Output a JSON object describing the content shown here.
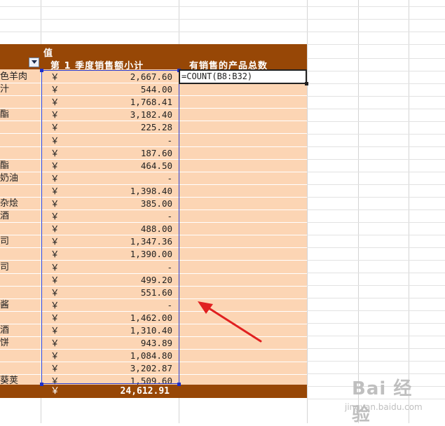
{
  "pivot": {
    "header_top": "值",
    "col1_header": "第 1 季度销售额小计",
    "col2_header": "有销售的产品总数",
    "formula": "=COUNT(B8:B32)",
    "currency": "￥",
    "total_value": "24,612.91",
    "rows": [
      {
        "name": "色羊肉",
        "value": "2,667.60"
      },
      {
        "name": "汁",
        "value": "544.00"
      },
      {
        "name": "",
        "value": "1,768.41"
      },
      {
        "name": "酯",
        "value": "3,182.40"
      },
      {
        "name": "",
        "value": "225.28"
      },
      {
        "name": "",
        "value": "-"
      },
      {
        "name": "",
        "value": "187.60"
      },
      {
        "name": "酯",
        "value": "464.50"
      },
      {
        "name": "奶油",
        "value": "-"
      },
      {
        "name": "",
        "value": "1,398.40"
      },
      {
        "name": "杂烩",
        "value": "385.00"
      },
      {
        "name": "酒",
        "value": "-"
      },
      {
        "name": "",
        "value": "488.00"
      },
      {
        "name": "司",
        "value": "1,347.36"
      },
      {
        "name": "",
        "value": "1,390.00"
      },
      {
        "name": "司",
        "value": "-"
      },
      {
        "name": "",
        "value": "499.20"
      },
      {
        "name": "",
        "value": "551.60"
      },
      {
        "name": "酱",
        "value": "-"
      },
      {
        "name": "",
        "value": "1,462.00"
      },
      {
        "name": "酒",
        "value": "1,310.40"
      },
      {
        "name": "饼",
        "value": "943.89"
      },
      {
        "name": "",
        "value": "1,084.80"
      },
      {
        "name": "",
        "value": "3,202.87"
      },
      {
        "name": "葵荚",
        "value": "1,509.60"
      }
    ]
  },
  "annotation": {
    "arrow_color": "#e02020"
  },
  "watermark": {
    "main": "Bai 经验",
    "sub": "jingyan.baidu.com"
  },
  "colors": {
    "header_bg": "#974706",
    "body_bg": "#fcd5b4",
    "selection": "#2a3cd0"
  }
}
